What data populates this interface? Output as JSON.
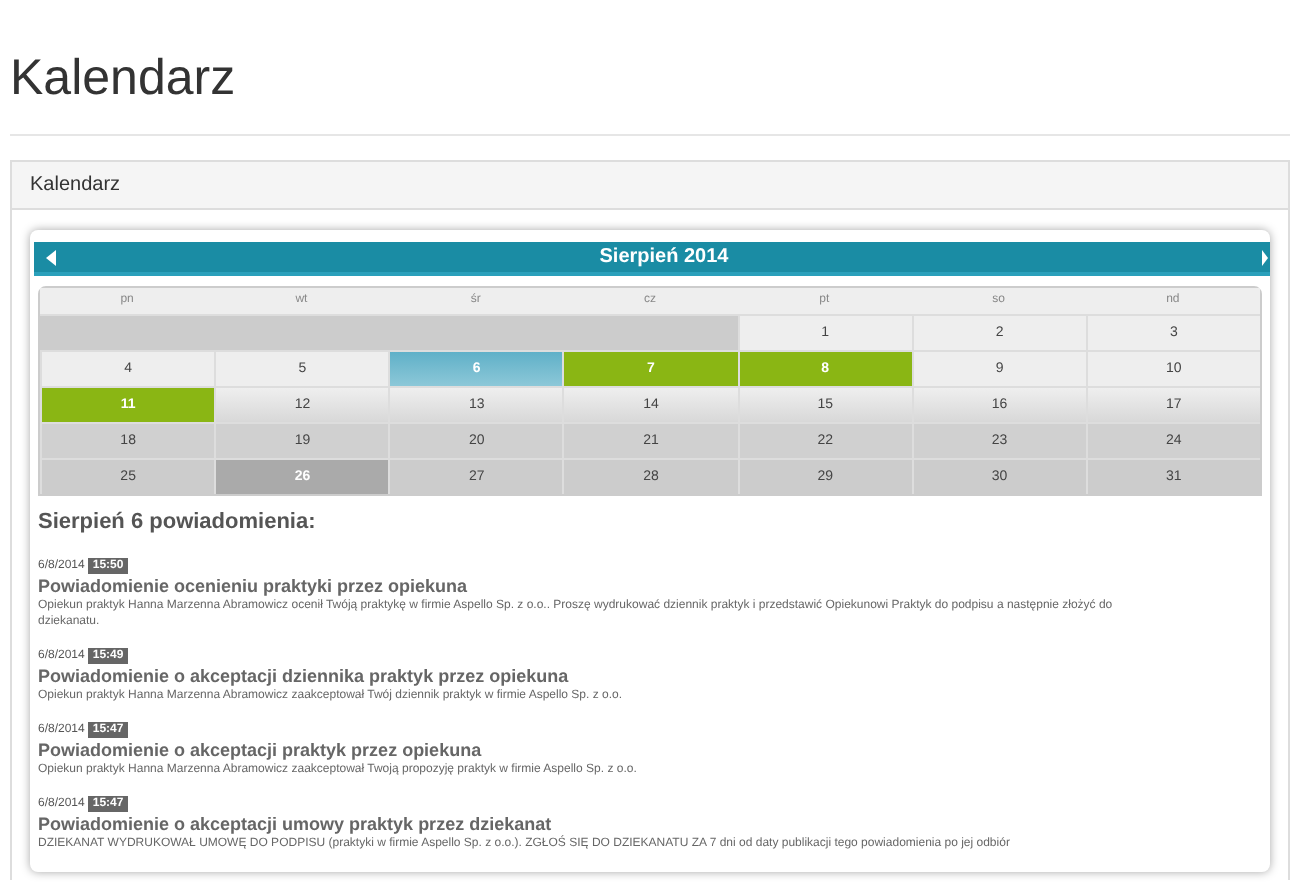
{
  "page_title": "Kalendarz",
  "panel": {
    "title": "Kalendarz"
  },
  "calendar": {
    "month": "Sierpień 2014",
    "weekdays": [
      "pn",
      "wt",
      "śr",
      "cz",
      "pt",
      "so",
      "nd"
    ],
    "weeks": [
      [
        {
          "kind": "blank"
        },
        {
          "day": "1",
          "kind": "day"
        },
        {
          "day": "2",
          "kind": "day"
        },
        {
          "day": "3",
          "kind": "day"
        }
      ],
      [
        {
          "day": "4",
          "kind": "day"
        },
        {
          "day": "5",
          "kind": "day"
        },
        {
          "day": "6",
          "kind": "selected"
        },
        {
          "day": "7",
          "kind": "event"
        },
        {
          "day": "8",
          "kind": "event"
        },
        {
          "day": "9",
          "kind": "day"
        },
        {
          "day": "10",
          "kind": "day"
        }
      ],
      [
        {
          "day": "11",
          "kind": "event"
        },
        {
          "day": "12",
          "kind": "day"
        },
        {
          "day": "13",
          "kind": "day"
        },
        {
          "day": "14",
          "kind": "day"
        },
        {
          "day": "15",
          "kind": "day"
        },
        {
          "day": "16",
          "kind": "day"
        },
        {
          "day": "17",
          "kind": "day"
        }
      ],
      [
        {
          "day": "18",
          "kind": "day"
        },
        {
          "day": "19",
          "kind": "day"
        },
        {
          "day": "20",
          "kind": "day"
        },
        {
          "day": "21",
          "kind": "day"
        },
        {
          "day": "22",
          "kind": "day"
        },
        {
          "day": "23",
          "kind": "day"
        },
        {
          "day": "24",
          "kind": "day"
        }
      ],
      [
        {
          "day": "25",
          "kind": "day"
        },
        {
          "day": "26",
          "kind": "today"
        },
        {
          "day": "27",
          "kind": "day"
        },
        {
          "day": "28",
          "kind": "day"
        },
        {
          "day": "29",
          "kind": "day"
        },
        {
          "day": "30",
          "kind": "day"
        },
        {
          "day": "31",
          "kind": "day"
        }
      ]
    ]
  },
  "notifications_title": "Sierpień 6 powiadomienia:",
  "notifications": [
    {
      "date": "6/8/2014",
      "time": "15:50",
      "title": "Powiadomienie ocenieniu praktyki przez opiekuna",
      "body": "Opiekun praktyk Hanna Marzenna Abramowicz ocenił Twóją praktykę w firmie Aspello Sp. z o.o.. Proszę wydrukować dziennik praktyk i przedstawić Opiekunowi Praktyk do podpisu a następnie złożyć do dziekanatu."
    },
    {
      "date": "6/8/2014",
      "time": "15:49",
      "title": "Powiadomienie o akceptacji dziennika praktyk przez opiekuna",
      "body": "Opiekun praktyk Hanna Marzenna Abramowicz zaakceptował Twój dziennik praktyk w firmie Aspello Sp. z o.o."
    },
    {
      "date": "6/8/2014",
      "time": "15:47",
      "title": "Powiadomienie o akceptacji praktyk przez opiekuna",
      "body": "Opiekun praktyk Hanna Marzenna Abramowicz zaakceptował Twoją propozyję praktyk w firmie Aspello Sp. z o.o."
    },
    {
      "date": "6/8/2014",
      "time": "15:47",
      "title": "Powiadomienie o akceptacji umowy praktyk przez dziekanat",
      "body": "DZIEKANAT WYDRUKOWAŁ UMOWĘ DO PODPISU (praktyki w firmie Aspello Sp. z o.o.). ZGŁOŚ SIĘ DO DZIEKANATU ZA 7 dni od daty publikacji tego powiadomienia po jej odbiór"
    }
  ]
}
